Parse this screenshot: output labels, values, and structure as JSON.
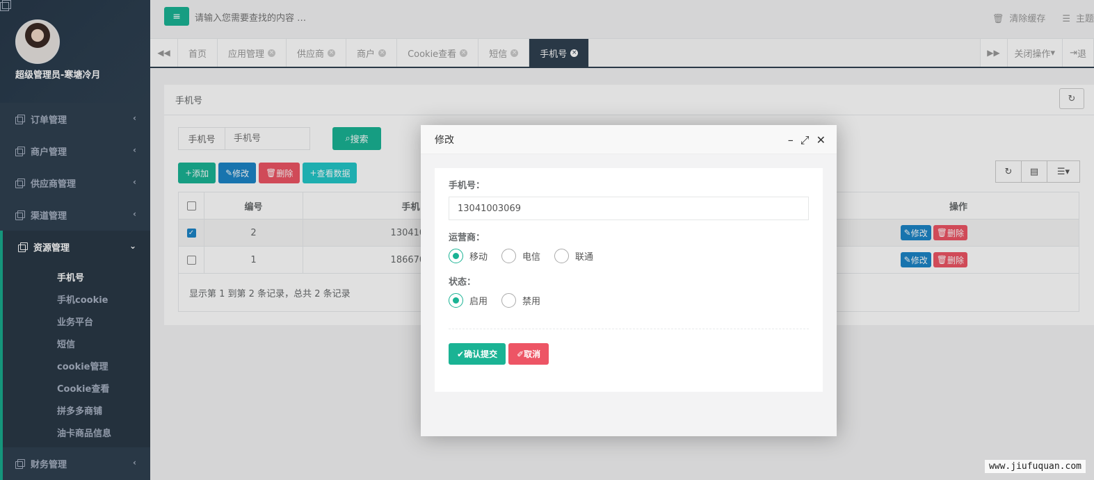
{
  "sidebar": {
    "user_name": "超级管理员-寒塘冷月",
    "menus": [
      {
        "label": "订单管理"
      },
      {
        "label": "商户管理"
      },
      {
        "label": "供应商管理"
      },
      {
        "label": "渠道管理"
      }
    ],
    "active_menu": {
      "label": "资源管理"
    },
    "submenu": [
      {
        "label": "手机号"
      },
      {
        "label": "手机cookie"
      },
      {
        "label": "业务平台"
      },
      {
        "label": "短信"
      },
      {
        "label": "cookie管理"
      },
      {
        "label": "Cookie查看"
      },
      {
        "label": "拼多多商铺"
      },
      {
        "label": "油卡商品信息"
      }
    ],
    "bottom_menu": {
      "label": "财务管理"
    }
  },
  "topbar": {
    "search_placeholder": "请输入您需要查找的内容 …",
    "clear_cache": "清除缓存",
    "theme": "主题"
  },
  "tabs": {
    "items": [
      "首页",
      "应用管理",
      "供应商",
      "商户",
      "Cookie查看",
      "短信",
      "手机号"
    ],
    "close_ops": "关闭操作",
    "logout": "退"
  },
  "panel": {
    "title": "手机号",
    "filter_label": "手机号",
    "filter_placeholder": "手机号",
    "search_btn": "搜索",
    "toolbar": {
      "add": "添加",
      "edit": "修改",
      "delete": "删除",
      "view": "查看数据"
    },
    "table": {
      "headers": {
        "id": "编号",
        "phone": "手机",
        "op": "操作"
      },
      "rows": [
        {
          "id": "2",
          "phone": "1304100",
          "edit": "修改",
          "delete": "删除"
        },
        {
          "id": "1",
          "phone": "1866703",
          "edit": "修改",
          "delete": "删除"
        }
      ]
    },
    "footer": "显示第 1 到第 2 条记录，总共 2 条记录"
  },
  "modal": {
    "title": "修改",
    "phone_label": "手机号：",
    "phone_value": "13041003069",
    "carrier_label": "运营商：",
    "carriers": [
      "移动",
      "电信",
      "联通"
    ],
    "status_label": "状态：",
    "statuses": [
      "启用",
      "禁用"
    ],
    "submit": "确认提交",
    "cancel": "取消"
  },
  "watermark": "www.jiufuquan.com",
  "colors": {
    "primary": "#1ab394",
    "blue": "#1c84c6",
    "danger": "#ed5565",
    "sidebar": "#2f4050"
  }
}
